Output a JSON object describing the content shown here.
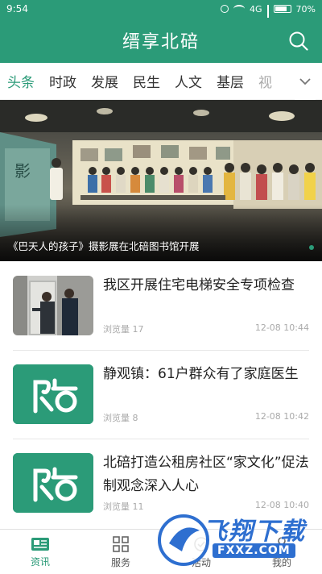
{
  "status_bar": {
    "time": "9:54",
    "signal_label": "4G",
    "battery": "70%"
  },
  "header": {
    "title": "缙享北碚"
  },
  "tabs": [
    {
      "label": "头条",
      "active": true
    },
    {
      "label": "时政"
    },
    {
      "label": "发展"
    },
    {
      "label": "民生"
    },
    {
      "label": "人文"
    },
    {
      "label": "基层"
    },
    {
      "label": "视"
    }
  ],
  "banner": {
    "caption": "《巴天人的孩子》摄影展在北碚图书馆开展",
    "poster_text": "影"
  },
  "news": [
    {
      "title": "我区开展住宅电梯安全专项检查",
      "views": "浏览量 17",
      "time": "12-08 10:44",
      "thumb": "photo"
    },
    {
      "title": "静观镇：61户群众有了家庭医生",
      "views": "浏览量 8",
      "time": "12-08 10:42",
      "thumb": "logo"
    },
    {
      "title": "北碚打造公租房社区“家文化”促法制观念深入人心",
      "views": "浏览量 11",
      "time": "12-08 10:40",
      "thumb": "logo"
    }
  ],
  "bottom_nav": [
    {
      "label": "资讯",
      "icon": "news-icon",
      "active": true
    },
    {
      "label": "服务",
      "icon": "grid-icon"
    },
    {
      "label": "活动",
      "icon": "activity-icon"
    },
    {
      "label": "我的",
      "icon": "user-icon"
    }
  ],
  "watermark": {
    "text": "飞翔下载",
    "url": "FXXZ.COM"
  },
  "colors": {
    "brand": "#2b9b78",
    "watermark": "#2e6fd0"
  }
}
